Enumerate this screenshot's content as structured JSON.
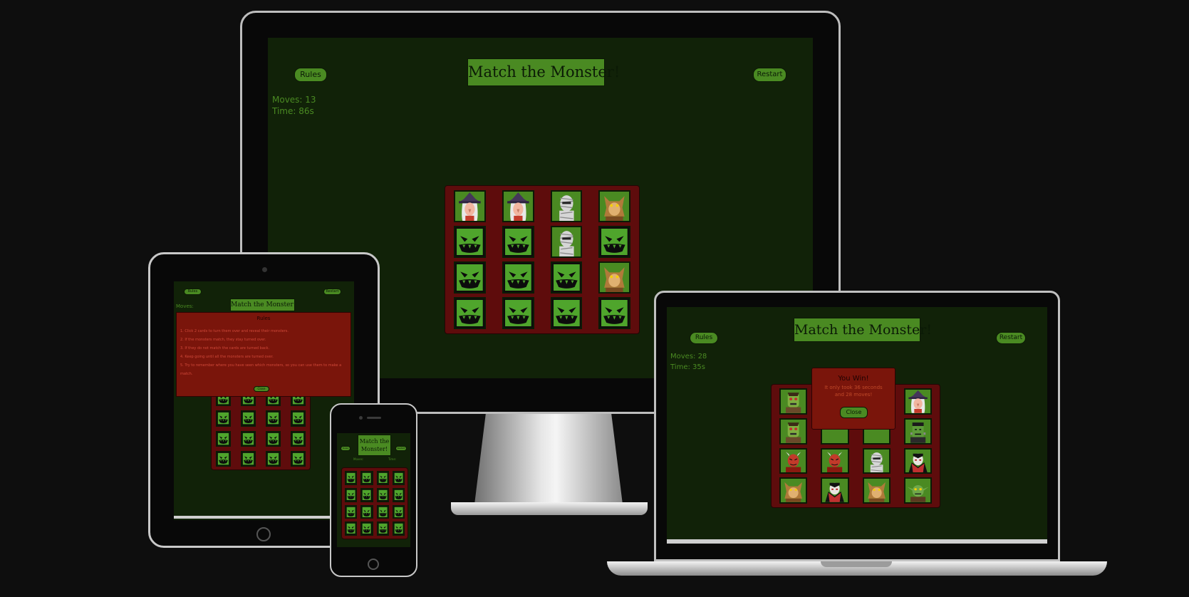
{
  "game": {
    "title": "Match the Monster!",
    "rules_label": "Rules",
    "restart_label": "Restart",
    "close_label": "Close"
  },
  "desktop": {
    "moves_text": "Moves: 13",
    "time_text": "Time: 86s",
    "cards": [
      "witch",
      "witch",
      "mummy",
      "werewolf",
      "down",
      "down",
      "mummy",
      "down",
      "down",
      "down",
      "down",
      "werewolf",
      "down",
      "down",
      "down",
      "down"
    ]
  },
  "laptop": {
    "moves_text": "Moves: 28",
    "time_text": "Time: 35s",
    "cards": [
      "zombie",
      "",
      "",
      "witch",
      "zombie",
      "",
      "",
      "frankenstein",
      "devil",
      "devil",
      "mummy",
      "vampire",
      "werewolf",
      "vampire",
      "werewolf",
      "goblin"
    ],
    "win_modal": {
      "title": "You Win!",
      "message": "It only took 36 seconds and 28 moves!"
    }
  },
  "tablet": {
    "moves_text": "Moves:",
    "rules_modal": {
      "title": "Rules",
      "rules": [
        "1. Click 2 cards to turn them over and reveal their monsters.",
        "2. If the monsters match, they stay turned over.",
        "3. If they do not match the cards are turned back.",
        "4. Keep going until all the monsters are turned over.",
        "5. Try to remember where you have seen which monsters, so you can use them to make a match."
      ]
    }
  },
  "phone": {
    "moves_label": "Moves:",
    "time_label": "Time:"
  },
  "colors": {
    "background": "#0e0e0e",
    "screen_bg": "#112208",
    "accent_green": "#4a8a22",
    "board_red": "#5e0c0c",
    "modal_red": "#7a150b"
  }
}
